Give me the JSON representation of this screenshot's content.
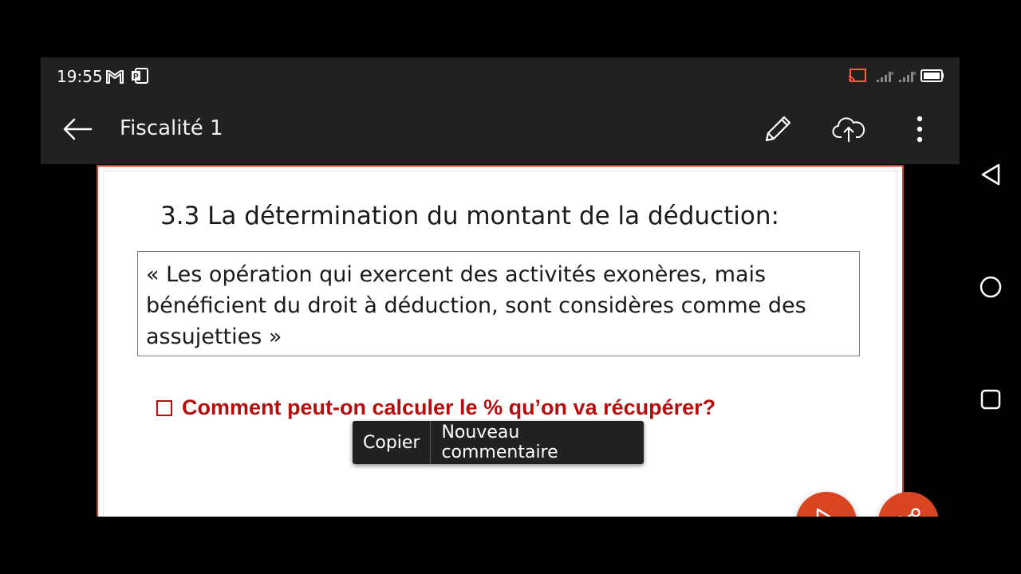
{
  "status_bar": {
    "time": "19:55",
    "left_icons": [
      "gmail-icon",
      "powerpoint-icon"
    ],
    "right_icons": [
      "cast-icon",
      "signal-icon",
      "signal-icon",
      "battery-icon"
    ]
  },
  "toolbar": {
    "back_icon": "back-arrow-icon",
    "title": "Fiscalité 1",
    "actions": [
      "edit-icon",
      "cloud-upload-icon",
      "more-vertical-icon"
    ]
  },
  "slide": {
    "heading": "3.3 La détermination du montant de la déduction:",
    "quote_lines": [
      "« Les opération qui exercent des activités exonères, mais",
      "bénéficient du droit à déduction, sont considères comme des",
      "assujetties »"
    ],
    "question": "Comment peut-on calculer le % qu’on va récupérer?"
  },
  "context_menu": {
    "items": [
      "Copier",
      "Nouveau commentaire"
    ]
  },
  "fabs": {
    "play_icon": "play-icon",
    "share_icon": "share-icon"
  },
  "colors": {
    "accent": "#d94421",
    "question_red": "#b30f0f",
    "toolbar_bg": "#212121"
  },
  "nav_bar": {
    "buttons": [
      "back-triangle-icon",
      "home-circle-icon",
      "recents-square-icon"
    ]
  }
}
